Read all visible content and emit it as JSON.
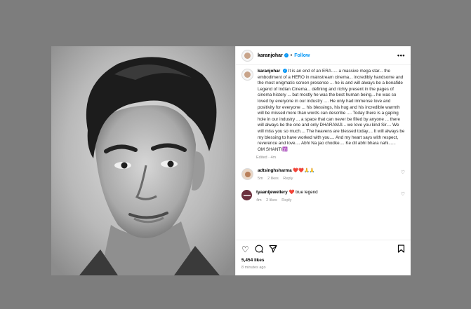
{
  "post": {
    "username": "karanjohar",
    "follow_label": "Follow",
    "separator": "•",
    "more_label": "•••"
  },
  "caption": {
    "username": "karanjohar",
    "text": "It is an end of an ERA..... a massive mega star... the embodiment of a HERO in mainstream cinema... incredibly handsome and the most enigmatic screen presence ... he is and will always be a bonafide Legend of Indian Cinema... defining and richly present in the pages of cinema history ... but mostly he was the best human being... he was so loved by everyone in our industry .... He only had immense love and positivity for everyone ... his blessings, his hug and his incredible warmth will be missed more than words can describe .... Today there is a gaping hole in our industry ... a space that can never be filled by anyone ... there will always be the one and only DHARAMJI... we love you kind Sir.... We will miss you so much.... The heavens are blessed today.... It will always be my blessing to have worked with you.... And my heart says with respect, reverence and love.... Abhi Na jao chodke.... Ke dil abhi bhara nahi......",
    "closing": "OM SHANTI🕉️",
    "edited": "Edited",
    "time": "4m"
  },
  "comments": [
    {
      "username": "adtsinghsharma",
      "text": "❤️❤️🙏🙏",
      "time": "5m",
      "likes": "2 likes",
      "reply": "Reply"
    },
    {
      "username": "tyaanijewellery",
      "text": "❤️ true legend",
      "time": "4m",
      "likes": "2 likes",
      "reply": "Reply"
    }
  ],
  "likes_count": "5,454 likes",
  "posted_ago": "8 minutes ago",
  "colors": {
    "link": "#0095f6",
    "muted": "#8e8e8e",
    "backdrop": "#7d7d7d"
  },
  "icons": [
    "verified-badge-icon",
    "more-options-icon",
    "heart-icon",
    "comment-icon",
    "share-icon",
    "bookmark-icon"
  ]
}
